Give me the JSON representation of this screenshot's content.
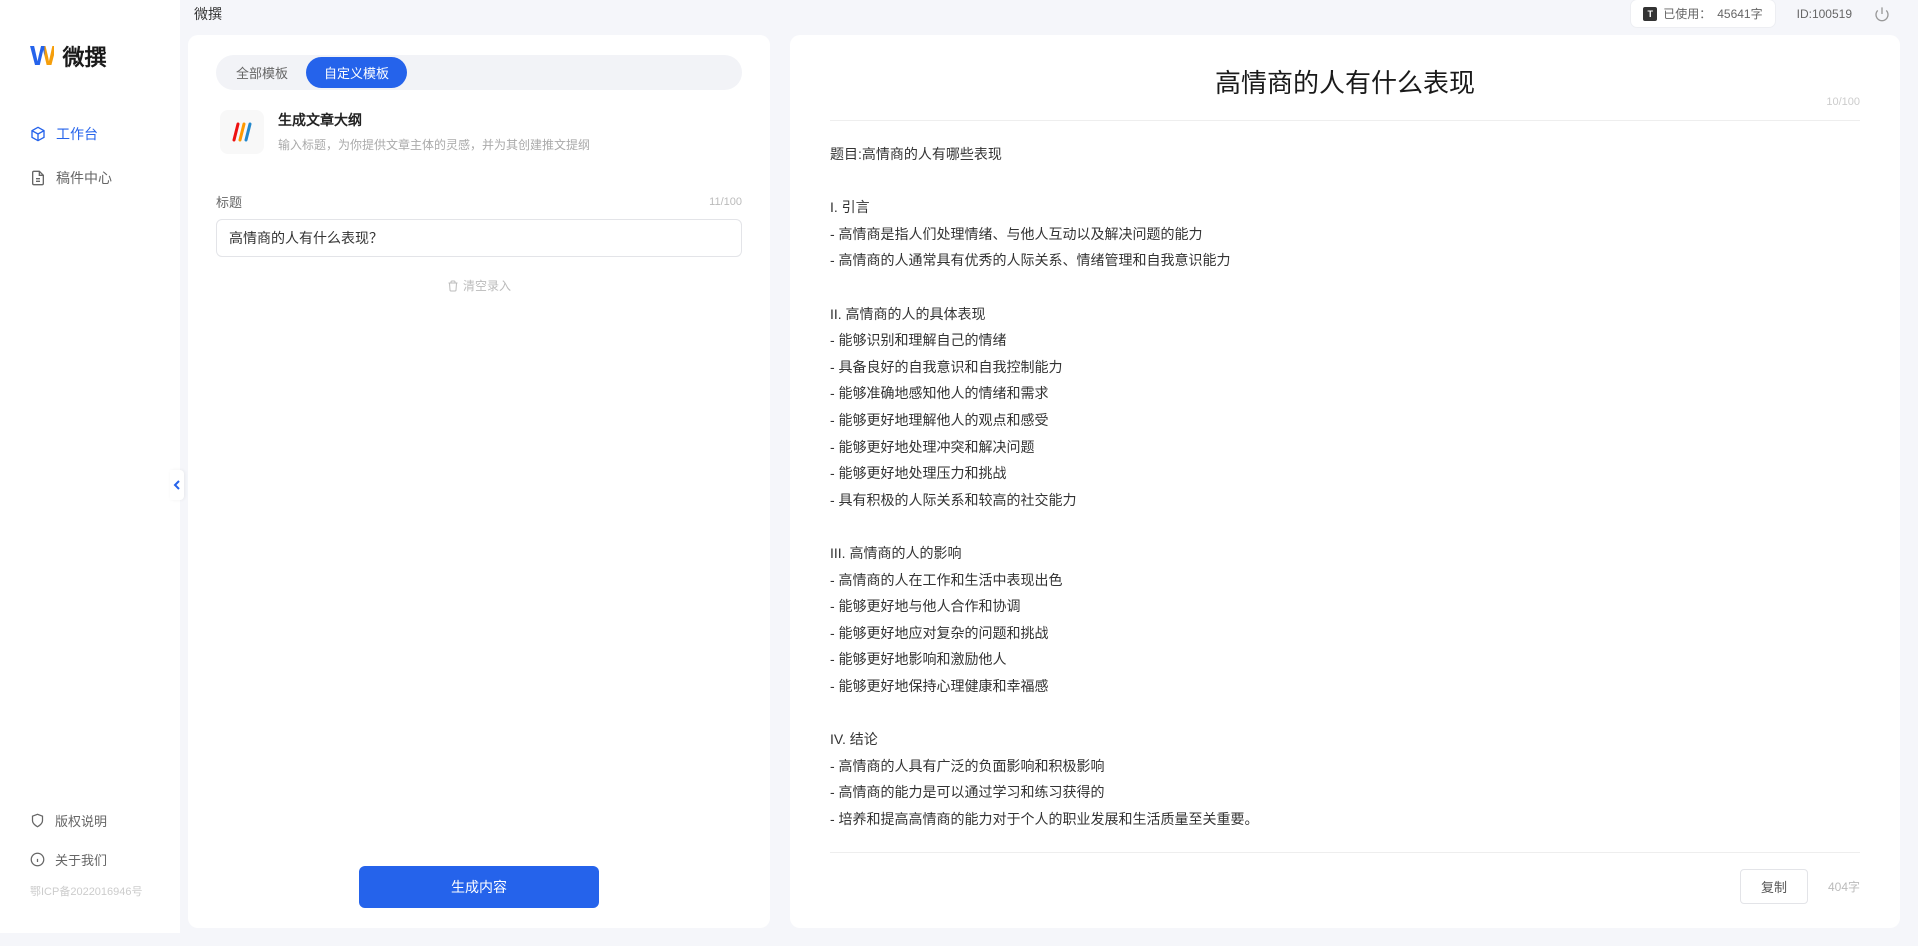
{
  "app": {
    "logo_text": "微撰",
    "title": "微撰"
  },
  "sidebar": {
    "nav": [
      {
        "label": "工作台",
        "icon": "cube",
        "active": true
      },
      {
        "label": "稿件中心",
        "icon": "doc",
        "active": false
      }
    ],
    "footer": [
      {
        "label": "版权说明",
        "icon": "shield"
      },
      {
        "label": "关于我们",
        "icon": "info"
      }
    ],
    "icp": "鄂ICP备2022016946号"
  },
  "topbar": {
    "usage_prefix": "已使用：",
    "usage_value": "45641字",
    "id_label": "ID:100519"
  },
  "left": {
    "tabs": [
      {
        "label": "全部模板",
        "active": false
      },
      {
        "label": "自定义模板",
        "active": true
      }
    ],
    "template": {
      "title": "生成文章大纲",
      "desc": "输入标题，为你提供文章主体的灵感，并为其创建推文提纲"
    },
    "form": {
      "label": "标题",
      "count": "11/100",
      "value": "高情商的人有什么表现？"
    },
    "clear": "清空录入",
    "generate": "生成内容"
  },
  "right": {
    "title": "高情商的人有什么表现",
    "top_count": "10/100",
    "body": "题目:高情商的人有哪些表现\n\nI. 引言\n- 高情商是指人们处理情绪、与他人互动以及解决问题的能力\n- 高情商的人通常具有优秀的人际关系、情绪管理和自我意识能力\n\nII. 高情商的人的具体表现\n- 能够识别和理解自己的情绪\n- 具备良好的自我意识和自我控制能力\n- 能够准确地感知他人的情绪和需求\n- 能够更好地理解他人的观点和感受\n- 能够更好地处理冲突和解决问题\n- 能够更好地处理压力和挑战\n- 具有积极的人际关系和较高的社交能力\n\nIII. 高情商的人的影响\n- 高情商的人在工作和生活中表现出色\n- 能够更好地与他人合作和协调\n- 能够更好地应对复杂的问题和挑战\n- 能够更好地影响和激励他人\n- 能够更好地保持心理健康和幸福感\n\nIV. 结论\n- 高情商的人具有广泛的负面影响和积极影响\n- 高情商的能力是可以通过学习和练习获得的\n- 培养和提高高情商的能力对于个人的职业发展和生活质量至关重要。",
    "copy": "复制",
    "word_count": "404字"
  }
}
